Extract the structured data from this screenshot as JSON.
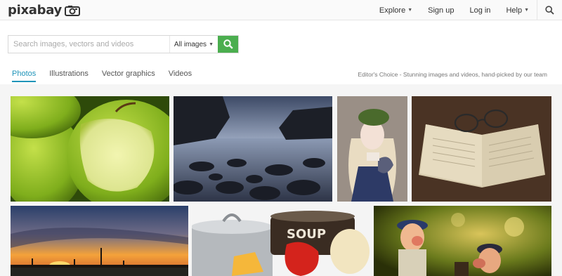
{
  "header": {
    "logo_text": "pixabay",
    "nav": [
      {
        "label": "Explore",
        "has_caret": true
      },
      {
        "label": "Sign up",
        "has_caret": false
      },
      {
        "label": "Log in",
        "has_caret": false
      },
      {
        "label": "Help",
        "has_caret": true
      }
    ],
    "search_icon": "search-icon"
  },
  "search": {
    "placeholder": "Search images, vectors and videos",
    "value": "",
    "type_selected": "All images",
    "button_icon": "search-icon",
    "button_color": "#4bae4f"
  },
  "tabs": [
    {
      "label": "Photos",
      "active": true
    },
    {
      "label": "Illustrations",
      "active": false
    },
    {
      "label": "Vector graphics",
      "active": false
    },
    {
      "label": "Videos",
      "active": false
    }
  ],
  "editor_note": "Editor's Choice - Stunning images and videos, hand-picked by our team",
  "colors": {
    "accent": "#1f94b9",
    "green": "#4bae4f"
  },
  "photos": [
    {
      "name": "photo-green-apples"
    },
    {
      "name": "photo-rocky-beach"
    },
    {
      "name": "photo-girl-doll"
    },
    {
      "name": "photo-book-glasses"
    },
    {
      "name": "photo-sunset-pier"
    },
    {
      "name": "photo-cooking-pots-soup"
    },
    {
      "name": "photo-figurines"
    }
  ]
}
